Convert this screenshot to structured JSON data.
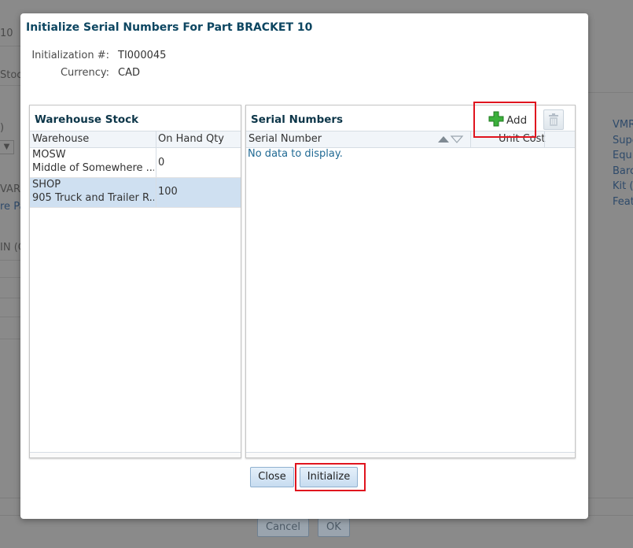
{
  "background": {
    "field_fragment": "10",
    "tab_fragment": "Stock",
    "paren_fragment": ")",
    "dropdown_chevron": "chevron-down-icon",
    "warr_fragment": "VARR",
    "link_fragment": "re Pa",
    "in_fragment": "IN (C",
    "side_links": [
      "VMR",
      "Supe",
      "Equi",
      "Barc",
      "Kit (",
      "Feat"
    ],
    "cancel_label": "Cancel",
    "ok_label": "OK"
  },
  "dialog": {
    "title": "Initialize Serial Numbers For Part BRACKET 10",
    "fields": [
      {
        "label": "Initialization #:",
        "value": "TI000045"
      },
      {
        "label": "Currency:",
        "value": "CAD"
      }
    ],
    "warehouse_panel": {
      "title": "Warehouse Stock",
      "columns": [
        "Warehouse",
        "On Hand Qty"
      ],
      "rows": [
        {
          "code": "MOSW",
          "name": "Middle of Somewhere ...",
          "qty": "0",
          "selected": false
        },
        {
          "code": "SHOP",
          "name": "905 Truck and Trailer R...",
          "qty": "100",
          "selected": true
        }
      ]
    },
    "serial_panel": {
      "title": "Serial Numbers",
      "add_label": "Add",
      "add_icon": "plus-icon",
      "delete_icon": "trash-icon",
      "sort_icon": "sort-arrows-icon",
      "columns": [
        "Serial Number",
        "Unit Cost"
      ],
      "empty_text": "No data to display."
    },
    "buttons": {
      "close_label": "Close",
      "initialize_label": "Initialize"
    },
    "highlight_color": "#e0141e"
  }
}
